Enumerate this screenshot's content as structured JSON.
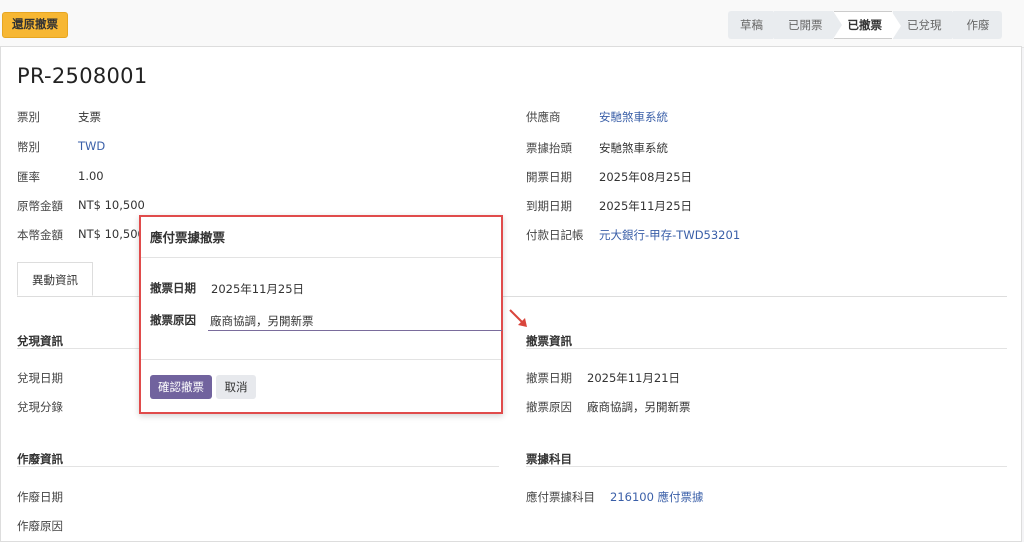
{
  "toolbar": {
    "restore_label": "還原撤票"
  },
  "status_steps": [
    "草稿",
    "已開票",
    "已撤票",
    "已兌現",
    "作廢"
  ],
  "status_active": "已撤票",
  "record": {
    "title": "PR-2508001"
  },
  "left_fields": [
    {
      "label": "票別",
      "value": "支票"
    },
    {
      "label": "幣別",
      "value": "TWD"
    },
    {
      "label": "匯率",
      "value": "1.00"
    },
    {
      "label": "原幣金額",
      "value": "NT$ 10,500"
    },
    {
      "label": "本幣金額",
      "value": "NT$ 10,500"
    }
  ],
  "right_fields": [
    {
      "label": "供應商",
      "value": "安馳煞車系統"
    },
    {
      "label": "票據抬頭",
      "value": "安馳煞車系統"
    },
    {
      "label": "開票日期",
      "value": "2025年08月25日"
    },
    {
      "label": "到期日期",
      "value": "2025年11月25日"
    },
    {
      "label": "付款日記帳",
      "value": "元大銀行-甲存-TWD53201"
    }
  ],
  "tab": {
    "label": "異動資訊"
  },
  "sections": {
    "cash": {
      "title": "兌現資訊",
      "date_label": "兌現日期",
      "entry_label": "兌現分錄"
    },
    "void": {
      "title": "作廢資訊",
      "date_label": "作廢日期",
      "reason_label": "作廢原因"
    },
    "withdraw": {
      "title": "撤票資訊",
      "date_label": "撤票日期",
      "date_value": "2025年11月21日",
      "reason_label": "撤票原因",
      "reason_value": "廠商協調，另開新票"
    },
    "account": {
      "title": "票據科目",
      "account_label": "應付票據科目",
      "account_value": "216100 應付票據"
    }
  },
  "dialog": {
    "title": "應付票據撤票",
    "date_label": "撤票日期",
    "date_value": "2025年11月25日",
    "reason_label": "撤票原因",
    "reason_value": "廠商協調，另開新票",
    "confirm_label": "確認撤票",
    "cancel_label": "取消"
  },
  "colors": {
    "accent": "#71639e",
    "warning": "#f7b733",
    "link": "#3a5fa8",
    "highlight": "#e04b4b"
  }
}
